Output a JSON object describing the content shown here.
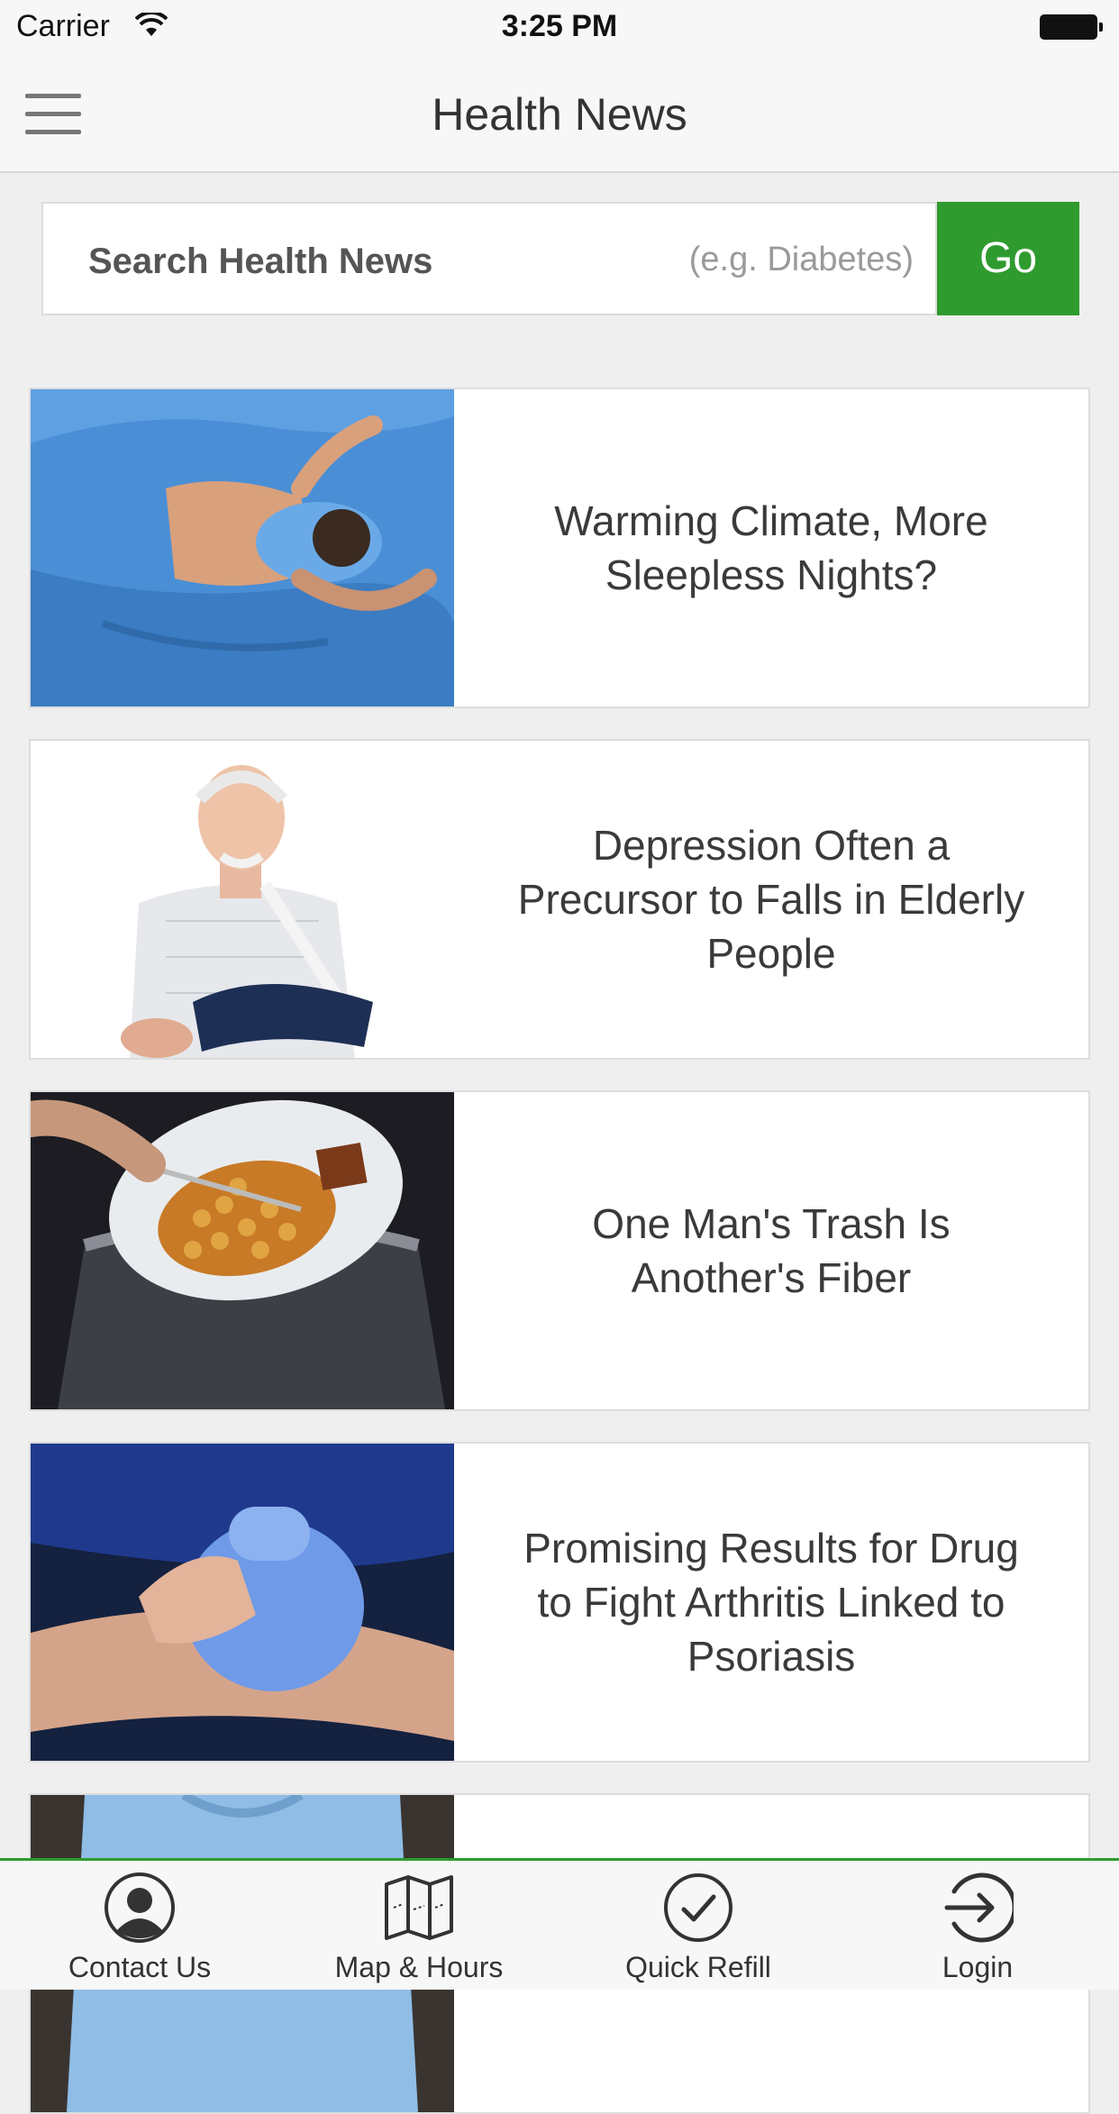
{
  "status_bar": {
    "carrier": "Carrier",
    "time": "3:25 PM"
  },
  "nav": {
    "title": "Health News",
    "menu_icon": "hamburger-menu-icon"
  },
  "search": {
    "label": "Search Health News",
    "placeholder": "(e.g. Diabetes)",
    "button": "Go"
  },
  "colors": {
    "accent": "#2f9b2f",
    "background": "#efefef"
  },
  "articles": [
    {
      "title": "Warming Climate, More Sleepless Nights?",
      "image": "man-sleeping-photo"
    },
    {
      "title": "Depression Often a Precursor to Falls in Elderly People",
      "image": "elderly-man-arm-sling-photo"
    },
    {
      "title": "One Man's Trash Is Another's Fiber",
      "image": "plate-food-trash-photo"
    },
    {
      "title": "Promising Results for Drug to Fight Arthritis Linked to Psoriasis",
      "image": "ice-pack-arm-photo"
    },
    {
      "title": "",
      "image": "person-blue-shirt-photo"
    }
  ],
  "tabs": [
    {
      "label": "Contact Us",
      "icon": "person-icon"
    },
    {
      "label": "Map & Hours",
      "icon": "map-icon"
    },
    {
      "label": "Quick Refill",
      "icon": "checkmark-circle-icon"
    },
    {
      "label": "Login",
      "icon": "login-arrow-icon"
    }
  ]
}
